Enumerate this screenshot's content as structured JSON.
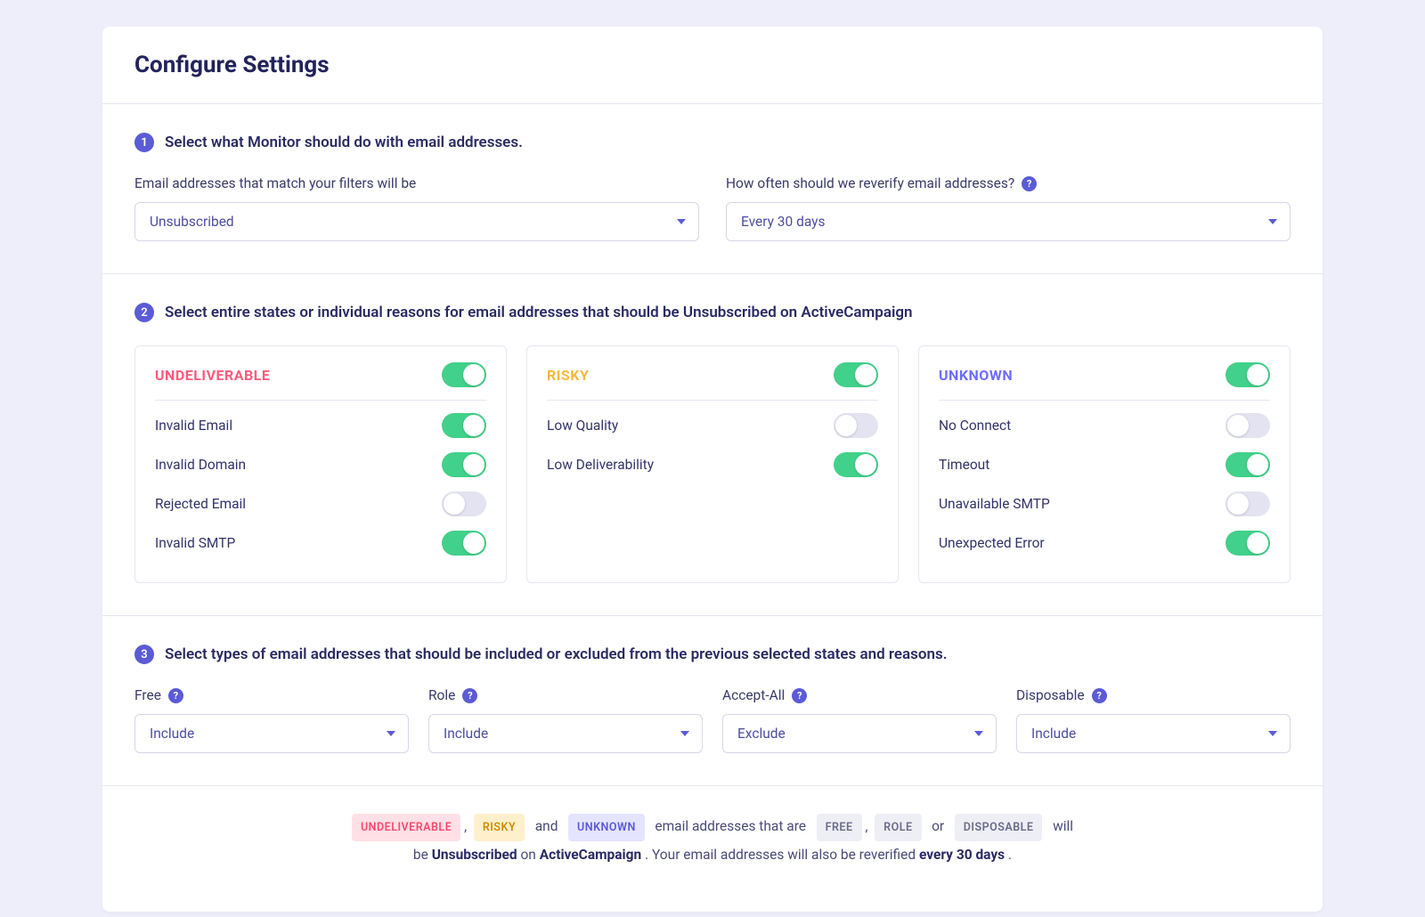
{
  "header": {
    "title": "Configure Settings"
  },
  "step1": {
    "num": "1",
    "title": "Select what Monitor should do with email addresses.",
    "action_label": "Email addresses that match your filters will be",
    "action_value": "Unsubscribed",
    "freq_label": "How often should we reverify email addresses?",
    "freq_value": "Every 30 days"
  },
  "step2": {
    "num": "2",
    "title": "Select entire states or individual reasons for email addresses that should be Unsubscribed on ActiveCampaign",
    "cards": [
      {
        "key": "undeliverable",
        "name": "UNDELIVERABLE",
        "color": "red",
        "on": true,
        "reasons": [
          {
            "label": "Invalid Email",
            "on": true
          },
          {
            "label": "Invalid Domain",
            "on": true
          },
          {
            "label": "Rejected Email",
            "on": false
          },
          {
            "label": "Invalid SMTP",
            "on": true
          }
        ]
      },
      {
        "key": "risky",
        "name": "RISKY",
        "color": "orange",
        "on": true,
        "reasons": [
          {
            "label": "Low Quality",
            "on": false
          },
          {
            "label": "Low Deliverability",
            "on": true
          }
        ]
      },
      {
        "key": "unknown",
        "name": "UNKNOWN",
        "color": "indigo",
        "on": true,
        "reasons": [
          {
            "label": "No Connect",
            "on": false
          },
          {
            "label": "Timeout",
            "on": true
          },
          {
            "label": "Unavailable SMTP",
            "on": false
          },
          {
            "label": "Unexpected Error",
            "on": true
          }
        ]
      }
    ]
  },
  "step3": {
    "num": "3",
    "title": "Select types of email addresses that should be included or excluded from the previous selected states and reasons.",
    "filters": [
      {
        "key": "free",
        "label": "Free",
        "value": "Include"
      },
      {
        "key": "role",
        "label": "Role",
        "value": "Include"
      },
      {
        "key": "accept-all",
        "label": "Accept-All",
        "value": "Exclude"
      },
      {
        "key": "disposable",
        "label": "Disposable",
        "value": "Include"
      }
    ]
  },
  "summary": {
    "pills": {
      "undeliverable": "UNDELIVERABLE",
      "risky": "RISKY",
      "unknown": "UNKNOWN",
      "free": "FREE",
      "role": "ROLE",
      "disposable": "DISPOSABLE"
    },
    "txt_and": "and",
    "txt_mid": "email addresses that are",
    "txt_or": "or",
    "txt_will": "will",
    "txt_be": "be ",
    "action_bold": "Unsubscribed",
    "txt_on": " on ",
    "service_bold": "ActiveCampaign",
    "txt_tail": ". Your email addresses will also be reverified ",
    "freq_bold": "every 30 days",
    "txt_period": "."
  }
}
